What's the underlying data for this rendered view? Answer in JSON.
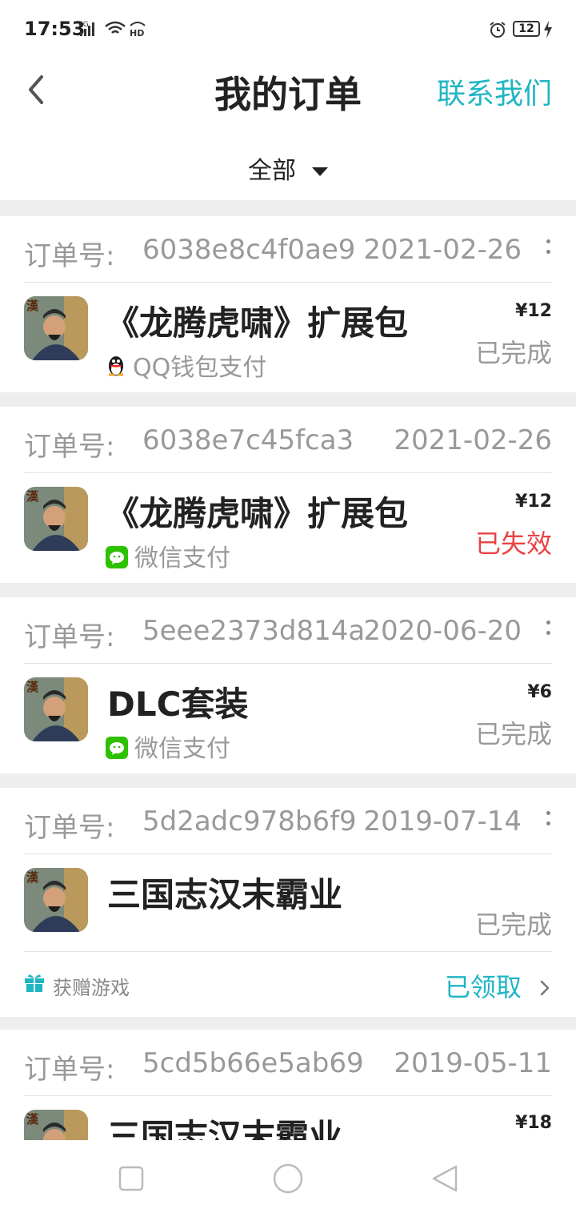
{
  "status_bar": {
    "time": "17:53",
    "network": "4G",
    "wifi_badge": "HD",
    "battery": "12"
  },
  "header": {
    "title": "我的订单",
    "contact": "联系我们"
  },
  "filter": {
    "label": "全部"
  },
  "order_label": "订单号:",
  "orders": [
    {
      "order_no": "6038e8c4f0ae9",
      "date": "2021-02-26",
      "product": "《龙腾虎啸》扩展包",
      "payment": "QQ钱包支付",
      "price": "¥12",
      "status": "已完成"
    },
    {
      "order_no": "6038e7c45fca3",
      "date": "2021-02-26",
      "product": "《龙腾虎啸》扩展包",
      "payment": "微信支付",
      "price": "¥12",
      "status": "已失效"
    },
    {
      "order_no": "5eee2373d814a",
      "date": "2020-06-20",
      "product": "DLC套装",
      "payment": "微信支付",
      "price": "¥6",
      "status": "已完成"
    },
    {
      "order_no": "5d2adc978b6f9",
      "date": "2019-07-14",
      "product": "三国志汉末霸业",
      "status": "已完成",
      "gift_label": "获赠游戏",
      "gift_action": "已领取"
    },
    {
      "order_no": "5cd5b66e5ab69",
      "date": "2019-05-11",
      "product": "三国志汉末霸业",
      "price": "¥18"
    }
  ],
  "icons": {
    "back": "chevron-left-icon",
    "more": "more-vertical-icon",
    "qq": "qq-penguin-icon",
    "wechat": "wechat-icon",
    "gift": "gift-icon",
    "game": "game-cover-icon"
  },
  "colors": {
    "accent": "#1fb5c4",
    "failed": "#e84343",
    "muted": "#999999",
    "gap": "#eeeeee"
  }
}
